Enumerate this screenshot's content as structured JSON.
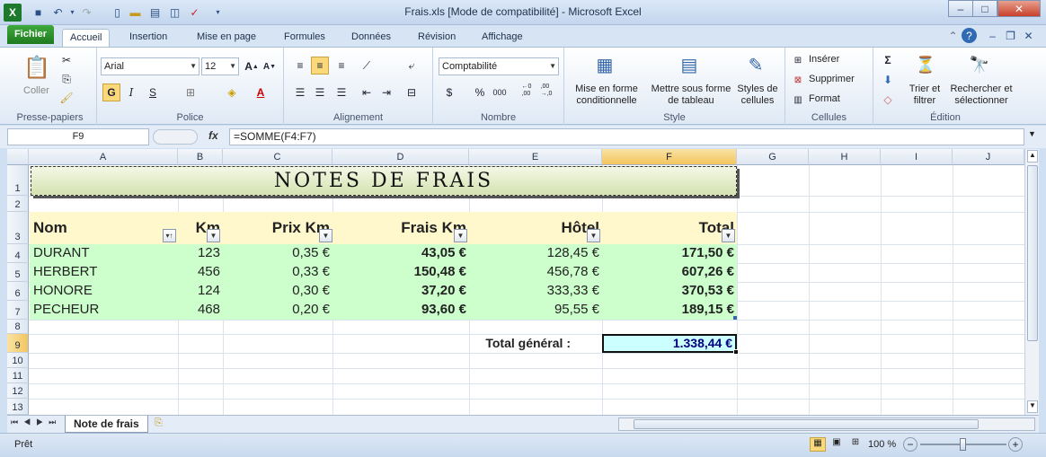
{
  "window": {
    "title": "Frais.xls  [Mode de compatibilité]  -  Microsoft Excel"
  },
  "qat": {
    "dropdown": "▾"
  },
  "tabs": {
    "file": "Fichier",
    "items": [
      "Accueil",
      "Insertion",
      "Mise en page",
      "Formules",
      "Données",
      "Révision",
      "Affichage"
    ]
  },
  "ribbon": {
    "clipboard": {
      "paste": "Coller",
      "label": "Presse-papiers"
    },
    "font": {
      "name": "Arial",
      "size": "12",
      "bold": "G",
      "italic": "I",
      "underline": "S",
      "label": "Police"
    },
    "alignment": {
      "label": "Alignement"
    },
    "number": {
      "format": "Comptabilité",
      "currency": "$",
      "percent": "%",
      "thousands": "000",
      "inc": "←0\n,00",
      "dec": ",00\n→,0",
      "label": "Nombre"
    },
    "style": {
      "cond_line1": "Mise en forme",
      "cond_line2": "conditionnelle",
      "table_line1": "Mettre sous forme",
      "table_line2": "de tableau",
      "cell_line1": "Styles de",
      "cell_line2": "cellules",
      "label": "Style"
    },
    "cells": {
      "insert": "Insérer",
      "delete": "Supprimer",
      "format": "Format",
      "label": "Cellules"
    },
    "editing": {
      "sum": "Σ",
      "sort_line1": "Trier et",
      "sort_line2": "filtrer",
      "find_line1": "Rechercher et",
      "find_line2": "sélectionner",
      "label": "Édition"
    }
  },
  "formula_bar": {
    "name_box": "F9",
    "fx": "fx",
    "formula": "=SOMME(F4:F7)"
  },
  "columns": [
    "A",
    "B",
    "C",
    "D",
    "E",
    "F",
    "G",
    "H",
    "I",
    "J"
  ],
  "rows": [
    "1",
    "2",
    "3",
    "4",
    "5",
    "6",
    "7",
    "8",
    "9",
    "10",
    "11",
    "12",
    "13"
  ],
  "sheet": {
    "title": "NOTES  DE  FRAIS",
    "headers": [
      "Nom",
      "Km",
      "Prix Km",
      "Frais Km",
      "Hôtel",
      "Total"
    ],
    "data": [
      [
        "DURANT",
        "123",
        "0,35 €",
        "43,05 €",
        "128,45 €",
        "171,50 €"
      ],
      [
        "HERBERT",
        "456",
        "0,33 €",
        "150,48 €",
        "456,78 €",
        "607,26 €"
      ],
      [
        "HONORE",
        "124",
        "0,30 €",
        "37,20 €",
        "333,33 €",
        "370,53 €"
      ],
      [
        "PECHEUR",
        "468",
        "0,20 €",
        "93,60 €",
        "95,55 €",
        "189,15 €"
      ]
    ],
    "total_label": "Total général :",
    "total_value": "1.338,44 €"
  },
  "sheet_tabs": {
    "active": "Note de frais"
  },
  "status": {
    "ready": "Prêt",
    "zoom": "100 %"
  },
  "colors": {
    "header_band": "#fff8cc",
    "data_band": "#ccffcc",
    "total_fill": "#ccffff",
    "total_text": "#000080",
    "selection": "#f3c55f"
  }
}
